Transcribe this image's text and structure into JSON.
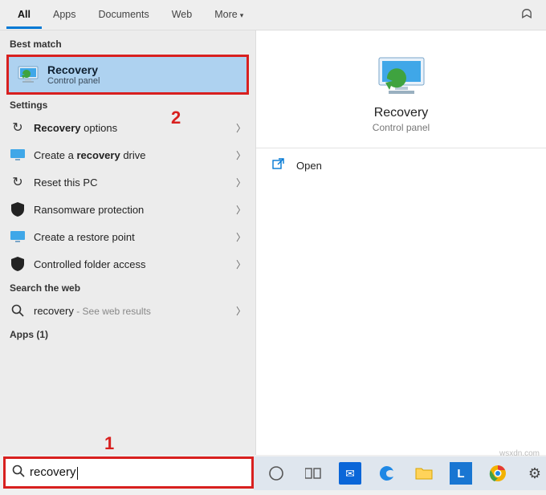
{
  "tabs": {
    "all": "All",
    "apps": "Apps",
    "documents": "Documents",
    "web": "Web",
    "more": "More"
  },
  "sections": {
    "best_match": "Best match",
    "settings": "Settings",
    "search_web": "Search the web",
    "apps_count": "Apps (1)"
  },
  "best_match": {
    "title": "Recovery",
    "subtitle": "Control panel"
  },
  "settings_items": [
    {
      "pre": "",
      "bold": "Recovery",
      "post": " options"
    },
    {
      "pre": "Create a ",
      "bold": "recovery",
      "post": " drive"
    },
    {
      "pre": "Reset this PC",
      "bold": "",
      "post": ""
    },
    {
      "pre": "Ransomware protection",
      "bold": "",
      "post": ""
    },
    {
      "pre": "Create a restore point",
      "bold": "",
      "post": ""
    },
    {
      "pre": "Controlled folder access",
      "bold": "",
      "post": ""
    }
  ],
  "web": {
    "term": "recovery",
    "suffix": " - See web results"
  },
  "preview": {
    "title": "Recovery",
    "subtitle": "Control panel",
    "open": "Open"
  },
  "search": {
    "value": "recovery"
  },
  "annotations": {
    "one": "1",
    "two": "2"
  },
  "watermark": "wsxdn.com"
}
